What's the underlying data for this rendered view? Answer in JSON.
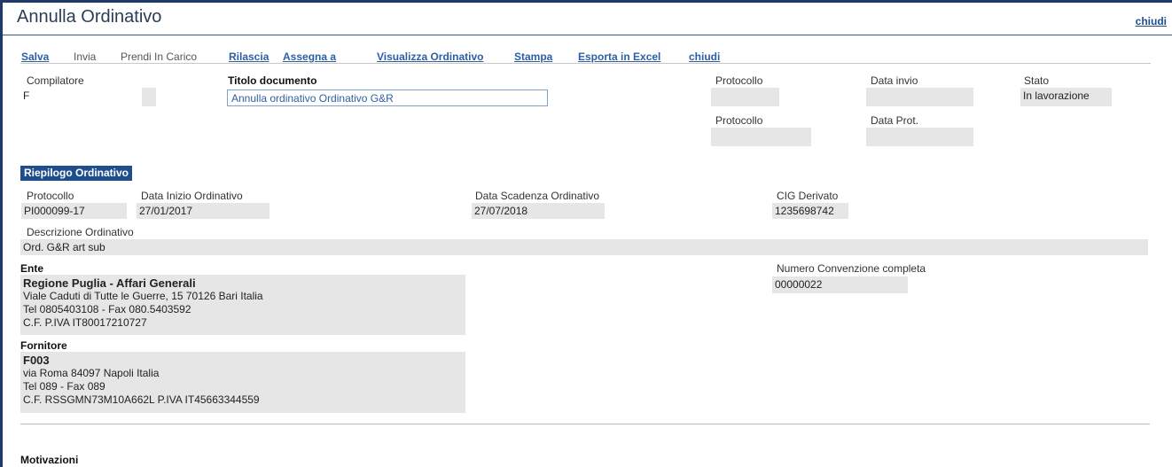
{
  "window": {
    "title": "Annulla Ordinativo",
    "close_label": "chiudi"
  },
  "toolbar": {
    "items": [
      {
        "label": "Salva",
        "enabled": true
      },
      {
        "label": "Invia",
        "enabled": false
      },
      {
        "label": "Prendi In Carico",
        "enabled": false
      },
      {
        "label": "Rilascia",
        "enabled": true
      },
      {
        "label": "Assegna a",
        "enabled": true
      },
      {
        "label": "Visualizza Ordinativo",
        "enabled": true
      },
      {
        "label": "Stampa",
        "enabled": true
      },
      {
        "label": "Esporta in Excel",
        "enabled": true
      },
      {
        "label": "chiudi",
        "enabled": true
      }
    ]
  },
  "header": {
    "compilatore": {
      "label": "Compilatore",
      "value": "F"
    },
    "titolo": {
      "label": "Titolo documento",
      "value": "Annulla ordinativo Ordinativo G&R"
    },
    "protocollo1": {
      "label": "Protocollo",
      "value": ""
    },
    "data_invio": {
      "label": "Data invio",
      "value": ""
    },
    "stato": {
      "label": "Stato",
      "value": "In lavorazione"
    },
    "protocollo2": {
      "label": "Protocollo",
      "value": ""
    },
    "data_prot": {
      "label": "Data Prot.",
      "value": ""
    }
  },
  "riepilogo": {
    "section_title": "Riepilogo Ordinativo",
    "protocollo": {
      "label": "Protocollo",
      "value": "PI000099-17"
    },
    "data_inizio": {
      "label": "Data Inizio Ordinativo",
      "value": "27/01/2017"
    },
    "data_scadenza": {
      "label": "Data Scadenza Ordinativo",
      "value": "27/07/2018"
    },
    "cig": {
      "label": "CIG Derivato",
      "value": "1235698742"
    },
    "descrizione": {
      "label": "Descrizione Ordinativo",
      "value": "Ord. G&R art sub"
    },
    "ente": {
      "label": "Ente",
      "name": "Regione Puglia - Affari Generali",
      "address": "Viale Caduti di Tutte le Guerre, 15 70126 Bari Italia",
      "contacts": "Tel 0805403108 - Fax 080.5403592",
      "fiscal": "C.F.  P.IVA IT80017210727"
    },
    "convenzione": {
      "label": "Numero Convenzione completa",
      "value": "00000022"
    },
    "fornitore": {
      "label": "Fornitore",
      "name": "F003",
      "address": "via Roma 84097 Napoli Italia",
      "contacts": "Tel 089 - Fax 089",
      "fiscal": "C.F. RSSGMN73M10A662L P.IVA IT45663344559"
    }
  },
  "motivazioni": {
    "label": "Motivazioni"
  }
}
